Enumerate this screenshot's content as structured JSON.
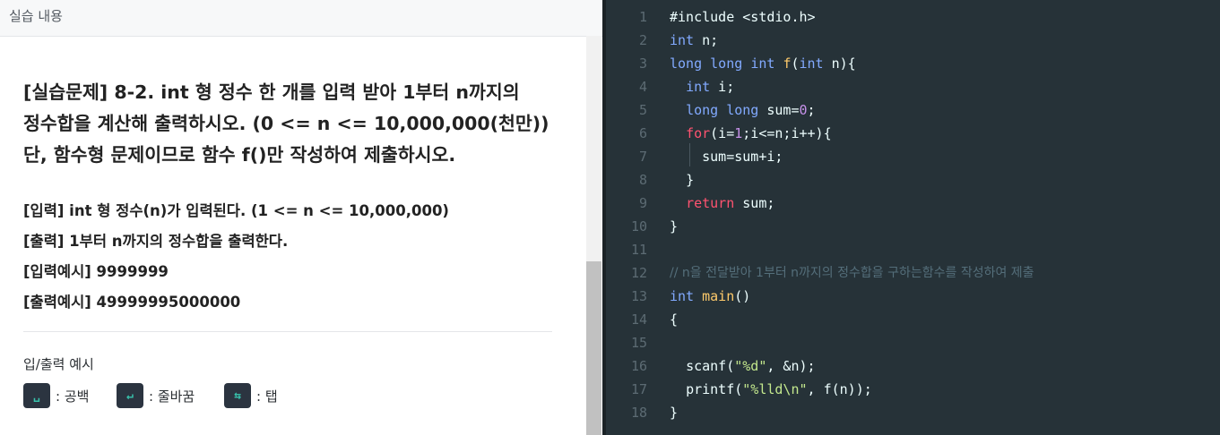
{
  "header": {
    "title": "실습 내용"
  },
  "problem": {
    "title_lines": [
      "[실습문제] 8-2. int 형 정수 한 개를 입력 받아 1부터 n까지의",
      "정수합을 계산해 출력하시오. (0 <= n <= 10,000,000(천만))",
      "단, 함수형 문제이므로 함수 f()만 작성하여 제출하시오."
    ],
    "input": "[입력] int 형 정수(n)가 입력된다. (1  <=  n  <=  10,000,000)",
    "output": "[출력] 1부터 n까지의 정수합을 출력한다.",
    "input_example": "[입력예시] 9999999",
    "output_example": "[출력예시] 49999995000000"
  },
  "io_legend": {
    "label": "입/출력 예시",
    "items": [
      {
        "key": "␣",
        "text": ": 공백",
        "icon": "space-icon"
      },
      {
        "key": "↵",
        "text": ": 줄바꿈",
        "icon": "newline-icon"
      },
      {
        "key": "⇆",
        "text": ": 탭",
        "icon": "tab-icon"
      }
    ]
  },
  "editor": {
    "line_numbers": [
      "1",
      "2",
      "3",
      "4",
      "5",
      "6",
      "7",
      "8",
      "9",
      "10",
      "11",
      "12",
      "13",
      "14",
      "15",
      "16",
      "17",
      "18"
    ],
    "tokens": {
      "include": "#include <stdio.h>",
      "int": "int",
      "long": "long",
      "n_decl": " n;",
      "f": "f",
      "open_paren": "(",
      "f_params_tail": " n){",
      "i_decl": " i;",
      "sum_decl": " sum=",
      "zero": "0",
      "semi": ";",
      "for": "for",
      "for_open": "(i=",
      "one": "1",
      "for_tail": ";i<=n;i++){",
      "sum_add": "sum=sum+i;",
      "close_brace": "}",
      "return": "return",
      "return_tail": " sum;",
      "comment": "// n을 전달받아 1부터 n까지의 정수합을 구하는함수를 작성하여 제출",
      "main": "main",
      "main_tail": "()",
      "open_brace": "{",
      "scanf": "scanf(",
      "scanf_fmt": "\"%d\"",
      "scanf_tail": ", &n);",
      "printf": "printf(",
      "printf_fmt": "\"%lld\\n\"",
      "printf_tail": ", f(n));"
    }
  },
  "colors": {
    "editor_bg": "#263238",
    "keyword": "#82aaff",
    "function": "#ffcb6b",
    "number": "#c792ea",
    "string": "#c3e88d",
    "control": "#ff5370",
    "comment": "#546e7a"
  }
}
